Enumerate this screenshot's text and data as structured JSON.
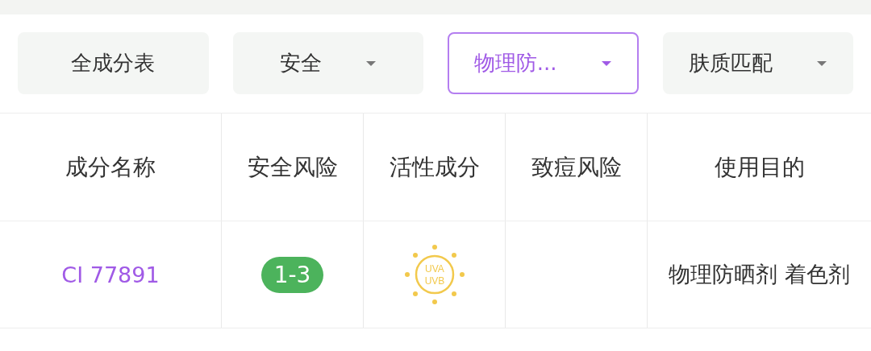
{
  "filters": [
    {
      "label": "全成分表",
      "dropdown": false,
      "selected": false
    },
    {
      "label": "安全",
      "dropdown": true,
      "selected": false
    },
    {
      "label": "物理防...",
      "dropdown": true,
      "selected": true
    },
    {
      "label": "肤质匹配",
      "dropdown": true,
      "selected": false
    }
  ],
  "table": {
    "columns": [
      "成分名称",
      "安全风险",
      "活性成分",
      "致痘风险",
      "使用目的"
    ],
    "rows": [
      {
        "name": "CI 77891",
        "risk": "1-3",
        "color": "#4cb35c",
        "active": {
          "kind": "sun",
          "labels": [
            "UVA",
            "UVB"
          ]
        },
        "purpose": "物理防晒剂 着色剂"
      }
    ]
  }
}
